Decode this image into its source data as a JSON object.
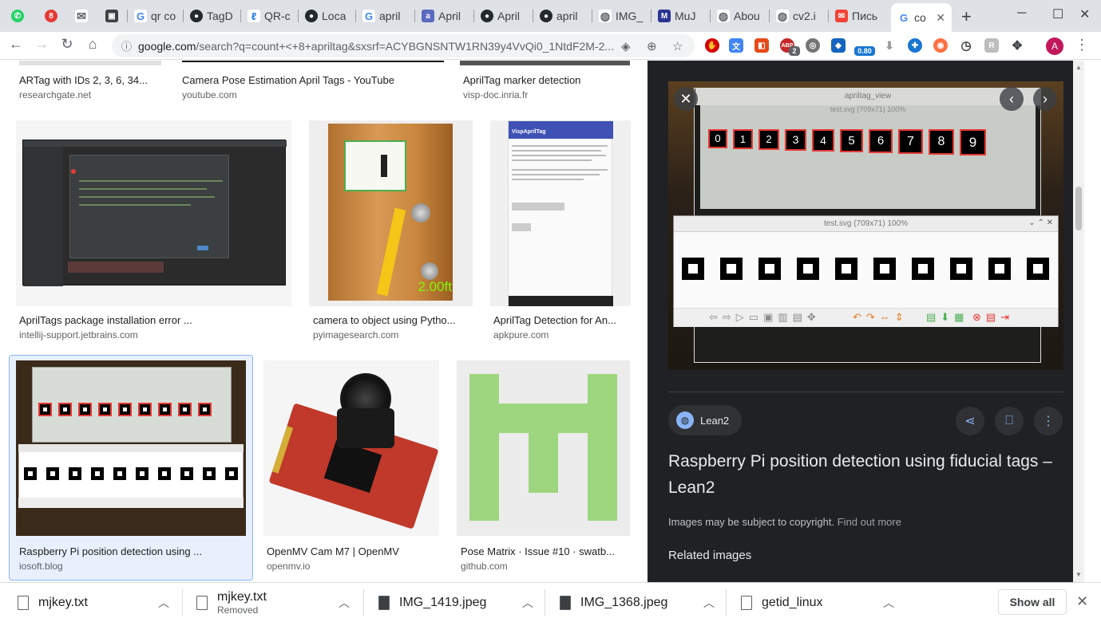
{
  "tabs": [
    {
      "label": "",
      "icon": "whatsapp-icon",
      "color": "#25d366",
      "glyph": "✆"
    },
    {
      "label": "",
      "icon": "notifier-icon",
      "color": "#e53935",
      "glyph": "8"
    },
    {
      "label": "",
      "icon": "mail-icon",
      "color": "#5f6368",
      "glyph": "✉"
    },
    {
      "label": "",
      "icon": "image-icon",
      "color": "#3c4043",
      "glyph": "▣"
    },
    {
      "label": "qr co",
      "icon": "google-icon",
      "color": "#4285f4",
      "glyph": "G"
    },
    {
      "label": "TagD",
      "icon": "github-icon",
      "color": "#24292e",
      "glyph": "●"
    },
    {
      "label": "QR-c",
      "icon": "paper-icon",
      "color": "#1a73e8",
      "glyph": "ℓ"
    },
    {
      "label": "Loca",
      "icon": "github-icon",
      "color": "#24292e",
      "glyph": "●"
    },
    {
      "label": "april",
      "icon": "google-icon",
      "color": "#4285f4",
      "glyph": "G"
    },
    {
      "label": "April",
      "icon": "april-icon",
      "color": "#5c6bc0",
      "glyph": "a"
    },
    {
      "label": "April",
      "icon": "github-icon",
      "color": "#24292e",
      "glyph": "●"
    },
    {
      "label": "april",
      "icon": "github-icon",
      "color": "#24292e",
      "glyph": "●"
    },
    {
      "label": "IMG_",
      "icon": "globe-icon",
      "color": "#5f6368",
      "glyph": "◍"
    },
    {
      "label": "MuJ",
      "icon": "m-icon",
      "color": "#283593",
      "glyph": "M"
    },
    {
      "label": "Abou",
      "icon": "globe-icon",
      "color": "#5f6368",
      "glyph": "◍"
    },
    {
      "label": "cv2.i",
      "icon": "globe-icon",
      "color": "#5f6368",
      "glyph": "◍"
    },
    {
      "label": "Пись",
      "icon": "yandex-mail-icon",
      "color": "#f44336",
      "glyph": "✉"
    },
    {
      "label": "co",
      "icon": "google-icon",
      "color": "#4285f4",
      "glyph": "G"
    }
  ],
  "address": {
    "host": "google.com",
    "path": "/search?q=count+<+8+apriltag&sxsrf=ACYBGNSNTW1RN39y4VvQi0_1NtdF2M-2..."
  },
  "extensions": [
    {
      "icon": "adblock-icon",
      "color": "#d50000",
      "glyph": "✋"
    },
    {
      "icon": "translate-icon",
      "color": "#4285f4",
      "glyph": "文"
    },
    {
      "icon": "office-icon",
      "color": "#e64a19",
      "glyph": "◧"
    },
    {
      "icon": "abp-icon",
      "color": "#c62828",
      "glyph": "ABP",
      "badge": "2"
    },
    {
      "icon": "film-icon",
      "color": "#757575",
      "glyph": "◎"
    },
    {
      "icon": "dictionary-icon",
      "color": "#1565c0",
      "glyph": "◆",
      "badge": "0.80"
    },
    {
      "icon": "download-icon",
      "color": "#9e9e9e",
      "glyph": "⬇"
    },
    {
      "icon": "vpn-icon",
      "color": "#1976d2",
      "glyph": "✚"
    },
    {
      "icon": "tomato-icon",
      "color": "#ff7043",
      "glyph": "◉"
    },
    {
      "icon": "timer-icon",
      "color": "#3c4043",
      "glyph": "◷"
    },
    {
      "icon": "r-icon",
      "color": "#bdbdbd",
      "glyph": "R"
    },
    {
      "icon": "gamepad-icon",
      "color": "#3c4043",
      "glyph": "✥"
    }
  ],
  "profile_initial": "A",
  "results_top": [
    {
      "title": "ARTag with IDs 2, 3, 6, 34...",
      "source": "researchgate.net"
    },
    {
      "title": "Camera Pose Estimation April Tags - YouTube",
      "source": "youtube.com"
    },
    {
      "title": "AprilTag marker detection",
      "source": "visp-doc.inria.fr"
    }
  ],
  "results_mid": [
    {
      "title": "AprilTags package installation error ...",
      "source": "intellij-support.jetbrains.com"
    },
    {
      "title": "camera to object using Pytho...",
      "source": "pyimagesearch.com",
      "overlay": "2.00ft"
    },
    {
      "title": "AprilTag Detection for An...",
      "source": "apkpure.com",
      "app_title": "VispAprilTag"
    }
  ],
  "results_bottom": [
    {
      "title": "Raspberry Pi position detection using ...",
      "source": "iosoft.blog"
    },
    {
      "title": "OpenMV Cam M7 | OpenMV",
      "source": "openmv.io"
    },
    {
      "title": "Pose Matrix · Issue #10 · swatb...",
      "source": "github.com"
    }
  ],
  "preview": {
    "window_top_title": "apriltag_view",
    "window_sub_title": "test.svg (709x71) 100%",
    "window_title": "test.svg (709x71) 100%",
    "tag_numbers": [
      "0",
      "1",
      "2",
      "3",
      "4",
      "5",
      "6",
      "7",
      "8",
      "9"
    ],
    "site": "Lean2",
    "title": "Raspberry Pi position detection using fiducial tags – Lean2",
    "copyright": "Images may be subject to copyright.",
    "find_out_more": "Find out more",
    "related": "Related images"
  },
  "downloads": [
    {
      "name": "mjkey.txt",
      "sub": "",
      "type": "txt"
    },
    {
      "name": "mjkey.txt",
      "sub": "Removed",
      "type": "txt"
    },
    {
      "name": "IMG_1419.jpeg",
      "sub": "",
      "type": "img"
    },
    {
      "name": "IMG_1368.jpeg",
      "sub": "",
      "type": "img"
    },
    {
      "name": "getid_linux",
      "sub": "",
      "type": "txt"
    }
  ],
  "show_all": "Show all"
}
